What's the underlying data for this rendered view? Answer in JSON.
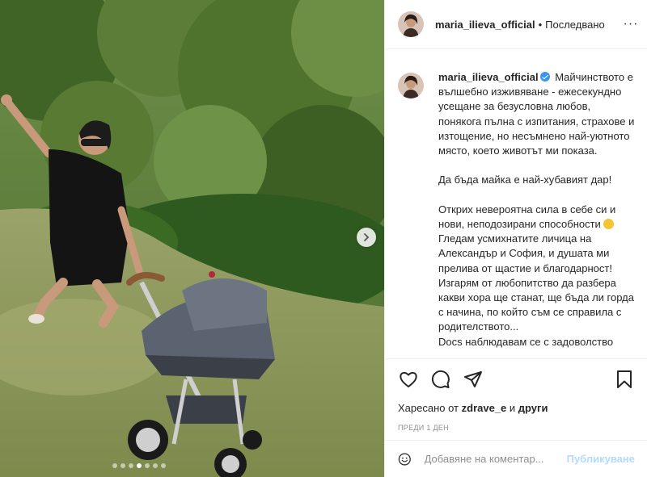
{
  "colors": {
    "accent": "#0095f6",
    "post_disabled": "#b3dbff",
    "muted": "#8e8e8e",
    "verified": "#3897f0"
  },
  "photo": {
    "alt_icons": [
      "next-arrow-icon"
    ],
    "carousel_total": 7,
    "carousel_active": 4
  },
  "header": {
    "username": "maria_ilieva_official",
    "separator": "•",
    "follow_label": "Последвано",
    "more_label": "···"
  },
  "caption": {
    "username": "maria_ilieva_official",
    "paragraph1": "Майчинството е вълшебно изживяване - ежесекундно усещане за безусловна любов, понякога пълна с изпитания, страхове и изтощение, но несъмнено най-уютното място, което животът ми показа.",
    "paragraph2": "Да бъда майка е най-хубавият дар!",
    "paragraph3a": "Открих невероятна сила в себе си и нови, неподозирани способности ",
    "paragraph3b": " Гледам усмихнатите личица на Александър и София, и душата ми прелива от щастие и благодарност! Изгарям от любопитство да разбера какви хора ще станат, ще бъда ли горда с начина, по който съм се справила с родителството...",
    "paragraph4": "Docs наблюдавам се с задоволство"
  },
  "actions": {
    "icons": [
      "heart-icon",
      "comment-icon",
      "share-icon",
      "bookmark-icon"
    ],
    "likes_prefix": "Харесано от ",
    "likes_user": "zdrave_e",
    "likes_and": " и ",
    "likes_others": "други",
    "time": "ПРЕДИ 1 ДЕН"
  },
  "comment": {
    "placeholder": "Добавяне на коментар...",
    "post_label": "Публикуване"
  }
}
